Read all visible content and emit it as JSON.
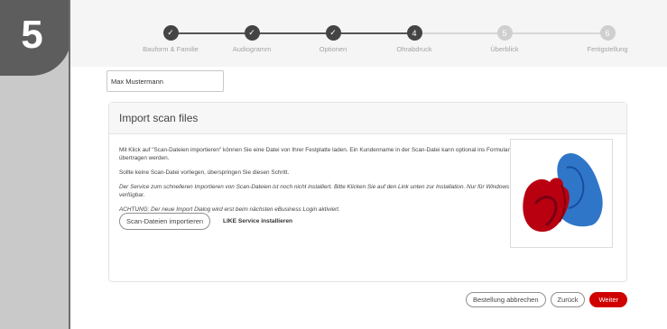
{
  "overlay": {
    "step_number": "5"
  },
  "stepper": {
    "steps": [
      {
        "label": "Bauform & Familie",
        "state": "done",
        "marker": "✓"
      },
      {
        "label": "Audiogramm",
        "state": "done",
        "marker": "✓"
      },
      {
        "label": "Optionen",
        "state": "done",
        "marker": "✓"
      },
      {
        "label": "Ohrabdruck",
        "state": "current",
        "marker": "4"
      },
      {
        "label": "Überblick",
        "state": "todo",
        "marker": "5"
      },
      {
        "label": "Fertigstellung",
        "state": "todo",
        "marker": "6"
      }
    ]
  },
  "customer": {
    "name": "Max Mustermann"
  },
  "import_card": {
    "title": "Import scan files",
    "paragraph_1": "Mit Klick auf \"Scan-Dateien importieren\" können Sie eine Datei von Ihrer Festplatte laden. Ein Kundenname in der Scan-Datei kann optional ins Formular übertragen werden.",
    "paragraph_2": "Sollte keine Scan-Datei vorliegen, überspringen Sie diesen Schritt.",
    "italic_1": "Der Service zum schnelleren Importieren von Scan-Dateien ist noch nicht installiert. Bitte Klicken Sie auf den Link unten zur Installation. Nur für Windows verfügbar.",
    "italic_2": "ACHTUNG: Der neue Import Dialog wird erst beim nächsten eBusiness Login aktiviert.",
    "import_button": "Scan-Dateien importieren",
    "service_link": "LIKE Service installieren"
  },
  "footer": {
    "cancel_button": "Bestellung abbrechen",
    "back_button": "Zurück",
    "next_button": "Weiter"
  },
  "colors": {
    "accent": "#d10000",
    "dark": "#444444",
    "inactive": "#cfcfcf"
  }
}
